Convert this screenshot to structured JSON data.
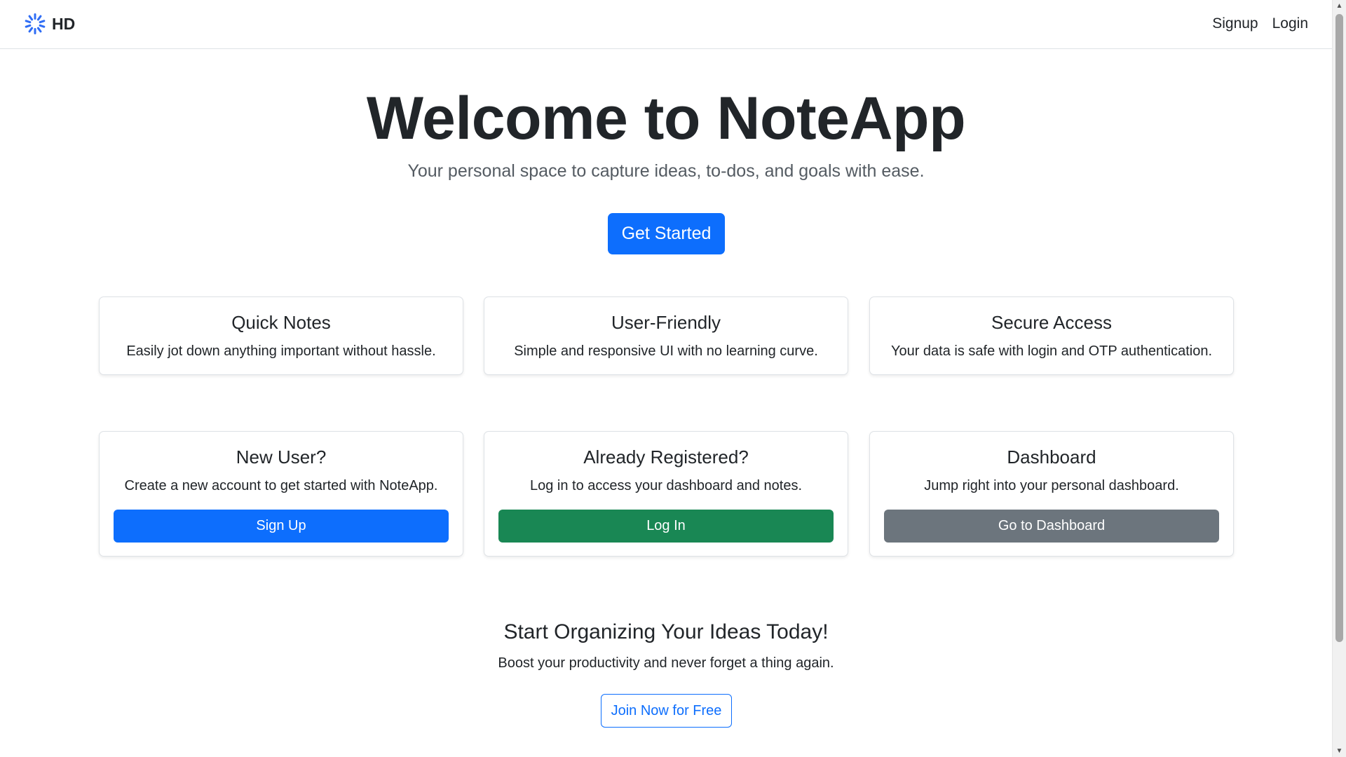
{
  "navbar": {
    "brand": "HD",
    "links": [
      "Signup",
      "Login"
    ]
  },
  "hero": {
    "title": "Welcome to NoteApp",
    "subtitle": "Your personal space to capture ideas, to-dos, and goals with ease.",
    "cta": "Get Started"
  },
  "features": [
    {
      "title": "Quick Notes",
      "text": "Easily jot down anything important without hassle."
    },
    {
      "title": "User-Friendly",
      "text": "Simple and responsive UI with no learning curve."
    },
    {
      "title": "Secure Access",
      "text": "Your data is safe with login and OTP authentication."
    }
  ],
  "actions": [
    {
      "title": "New User?",
      "text": "Create a new account to get started with NoteApp.",
      "button": "Sign Up"
    },
    {
      "title": "Already Registered?",
      "text": "Log in to access your dashboard and notes.",
      "button": "Log In"
    },
    {
      "title": "Dashboard",
      "text": "Jump right into your personal dashboard.",
      "button": "Go to Dashboard"
    }
  ],
  "cta": {
    "title": "Start Organizing Your Ideas Today!",
    "text": "Boost your productivity and never forget a thing again.",
    "button": "Join Now for Free"
  },
  "colors": {
    "primary": "#0d6efd",
    "success": "#198754",
    "secondary": "#6c757d",
    "text": "#212529"
  },
  "icons": {
    "brand": "spinner-star-icon"
  }
}
